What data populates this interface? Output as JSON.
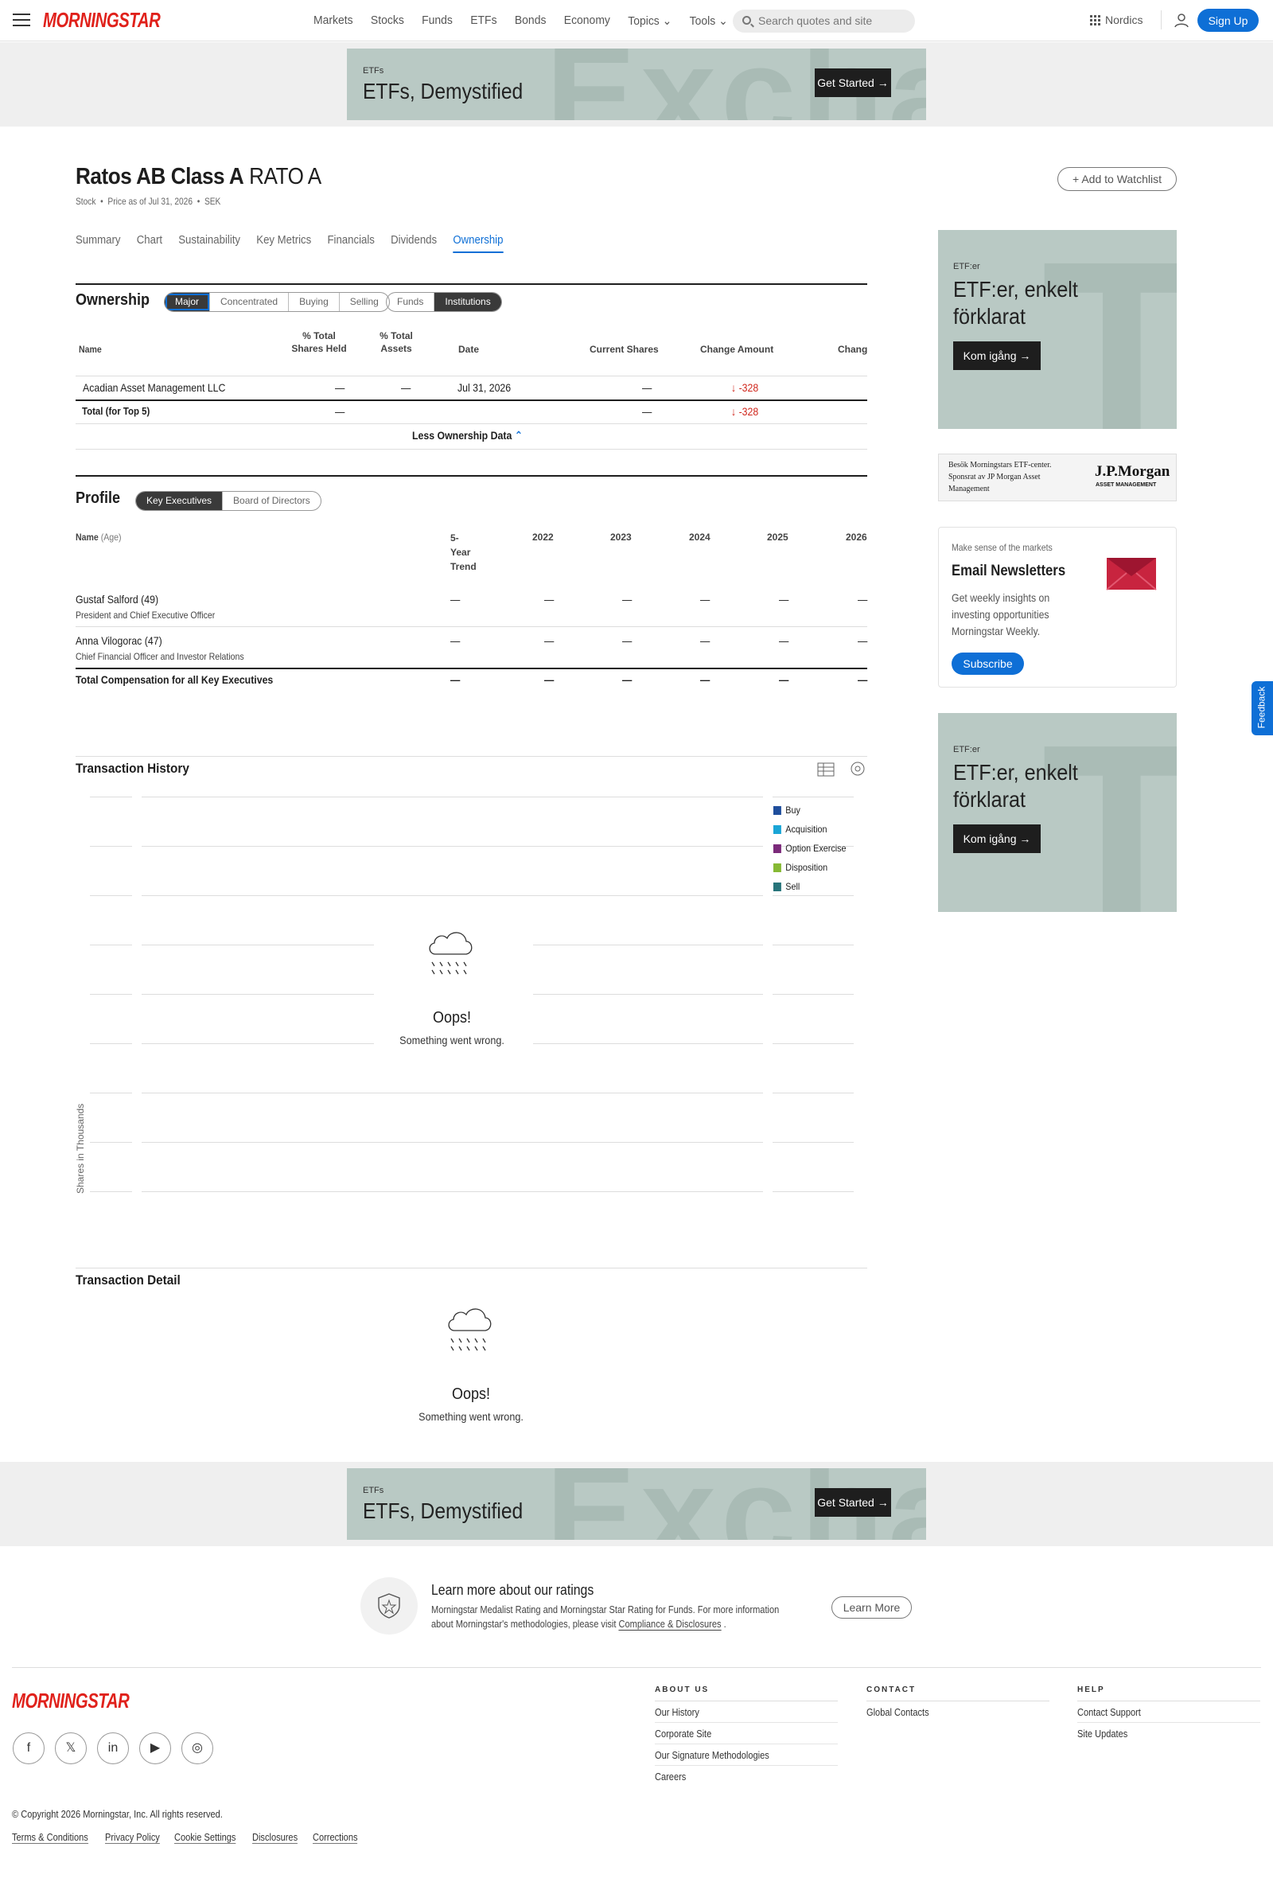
{
  "header": {
    "logo": "MORNINGSTAR",
    "nav": [
      "Markets",
      "Stocks",
      "Funds",
      "ETFs",
      "Bonds",
      "Economy",
      "Topics",
      "Tools"
    ],
    "search_placeholder": "Search quotes and site",
    "region": "Nordics",
    "signup": "Sign Up"
  },
  "banner": {
    "small": "ETFs",
    "title": "ETFs, Demystified",
    "button": "Get Started →",
    "bg_word": "Exchan"
  },
  "security": {
    "name": "Ratos AB Class A",
    "ticker": "RATO A",
    "type": "Stock",
    "price_as_of": "Price as of Jul 31, 2026",
    "currency": "SEK",
    "watchlist": "Add to Watchlist"
  },
  "tabs": [
    "Summary",
    "Chart",
    "Sustainability",
    "Key Metrics",
    "Financials",
    "Dividends",
    "Ownership"
  ],
  "ownership": {
    "title": "Ownership",
    "filters": [
      "Major",
      "Concentrated",
      "Buying",
      "Selling"
    ],
    "types": [
      "Funds",
      "Institutions"
    ],
    "columns": [
      "Name",
      "% Total Shares Held",
      "% Total Assets",
      "Date",
      "Current Shares",
      "Change Amount",
      "Change"
    ],
    "col_total_shares_1": "% Total",
    "col_total_shares_2": "Shares Held",
    "col_total_assets_1": "% Total",
    "col_total_assets_2": "Assets",
    "rows": [
      {
        "name": "Acadian Asset Management LLC",
        "shares_held": "—",
        "assets": "—",
        "date": "Jul 31, 2026",
        "current": "—",
        "change_amount": "-328"
      }
    ],
    "total": {
      "name": "Total (for Top 5)",
      "shares_held": "—",
      "current": "—",
      "change_amount": "-328"
    },
    "less": "Less Ownership Data"
  },
  "profile": {
    "title": "Profile",
    "toggles": [
      "Key Executives",
      "Board of Directors"
    ],
    "name_col": "Name",
    "age_col": "(Age)",
    "trend_col": [
      "5-",
      "Year",
      "Trend"
    ],
    "years": [
      "2022",
      "2023",
      "2024",
      "2025",
      "2026"
    ],
    "executives": [
      {
        "name": "Gustaf Salford (49)",
        "title": "President and Chief Executive Officer"
      },
      {
        "name": "Anna Vilogorac (47)",
        "title": "Chief Financial Officer and Investor Relations"
      }
    ],
    "dash": "—",
    "total": "Total Compensation for all Key Executives"
  },
  "transactions": {
    "history_title": "Transaction History",
    "ylabel": "Shares in Thousands",
    "legend": [
      {
        "label": "Buy",
        "color": "#1f4e9c"
      },
      {
        "label": "Acquisition",
        "color": "#1aa5d6"
      },
      {
        "label": "Option Exercise",
        "color": "#7b2a7a"
      },
      {
        "label": "Disposition",
        "color": "#86b934"
      },
      {
        "label": "Sell",
        "color": "#27747a"
      }
    ],
    "detail_title": "Transaction Detail",
    "oops": "Oops!",
    "error": "Something went wrong."
  },
  "sidebar": {
    "ad": {
      "small": "ETF:er",
      "title_1": "ETF:er, enkelt",
      "title_2": "förklarat",
      "button": "Kom igång →"
    },
    "jpm": {
      "text_1": "Besök Morningstars ETF-center.",
      "text_2": "Sponsrat av JP Morgan Asset",
      "text_3": "Management",
      "logo": "J.P.Morgan",
      "logo_sub": "ASSET MANAGEMENT"
    },
    "newsletter": {
      "kicker": "Make sense of the markets",
      "title": "Email Newsletters",
      "body_1": "Get weekly insights on",
      "body_2": "investing opportunities",
      "body_3": "Morningstar Weekly.",
      "button": "Subscribe"
    },
    "feedback": "Feedback"
  },
  "ratings": {
    "title": "Learn more about our ratings",
    "body_1": "Morningstar Medalist Rating and Morningstar Star Rating for Funds. For more information",
    "body_2": "about Morningstar's methodologies, please visit",
    "link": "Compliance & Disclosures",
    "button": "Learn More"
  },
  "footer": {
    "logo": "MORNINGSTAR",
    "about": {
      "title": "ABOUT US",
      "items": [
        "Our History",
        "Corporate Site",
        "Our Signature Methodologies",
        "Careers"
      ]
    },
    "contact": {
      "title": "CONTACT",
      "items": [
        "Global Contacts"
      ]
    },
    "help": {
      "title": "HELP",
      "items": [
        "Contact Support",
        "Site Updates"
      ]
    },
    "copyright": "© Copyright 2026 Morningstar, Inc. All rights reserved.",
    "links": [
      "Terms & Conditions",
      "Privacy Policy",
      "Cookie Settings",
      "Disclosures",
      "Corrections"
    ]
  }
}
